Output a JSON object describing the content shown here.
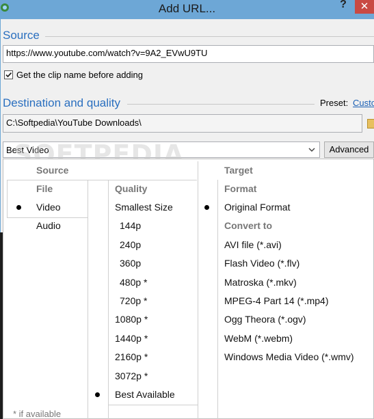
{
  "window": {
    "title": "Add URL...",
    "help_glyph": "?",
    "close_glyph": "✕"
  },
  "source": {
    "heading": "Source",
    "url_value": "https://www.youtube.com/watch?v=9A2_EVwU9TU",
    "checkbox_label": "Get the clip name before adding",
    "checkbox_checked": true
  },
  "destination": {
    "heading": "Destination and quality",
    "preset_label": "Preset:",
    "preset_value": "Custo",
    "folder_path": "C:\\Softpedia\\YouTube Downloads\\"
  },
  "quality_select": {
    "value": "Best Video"
  },
  "advanced_button": "Advanced",
  "watermark": "SOFTPEDIA",
  "panel": {
    "source_header": "Source",
    "target_header": "Target",
    "file_header": "File",
    "file_items": [
      "Video",
      "Audio"
    ],
    "file_selected": "Video",
    "quality_header": "Quality",
    "quality_items": [
      "Smallest Size",
      "144p",
      "240p",
      "360p",
      "480p *",
      "720p *",
      "1080p *",
      "1440p *",
      "2160p *",
      "3072p *",
      "Best Available"
    ],
    "quality_selected": "Best Available",
    "format_header": "Format",
    "format_original": "Original Format",
    "format_selected": "Original Format",
    "convert_header": "Convert to",
    "convert_items": [
      "AVI file (*.avi)",
      "Flash Video (*.flv)",
      "Matroska (*.mkv)",
      "MPEG-4 Part 14 (*.mp4)",
      "Ogg Theora (*.ogv)",
      "WebM (*.webm)",
      "Windows Media Video (*.wmv)"
    ],
    "footnote": "* if available"
  }
}
